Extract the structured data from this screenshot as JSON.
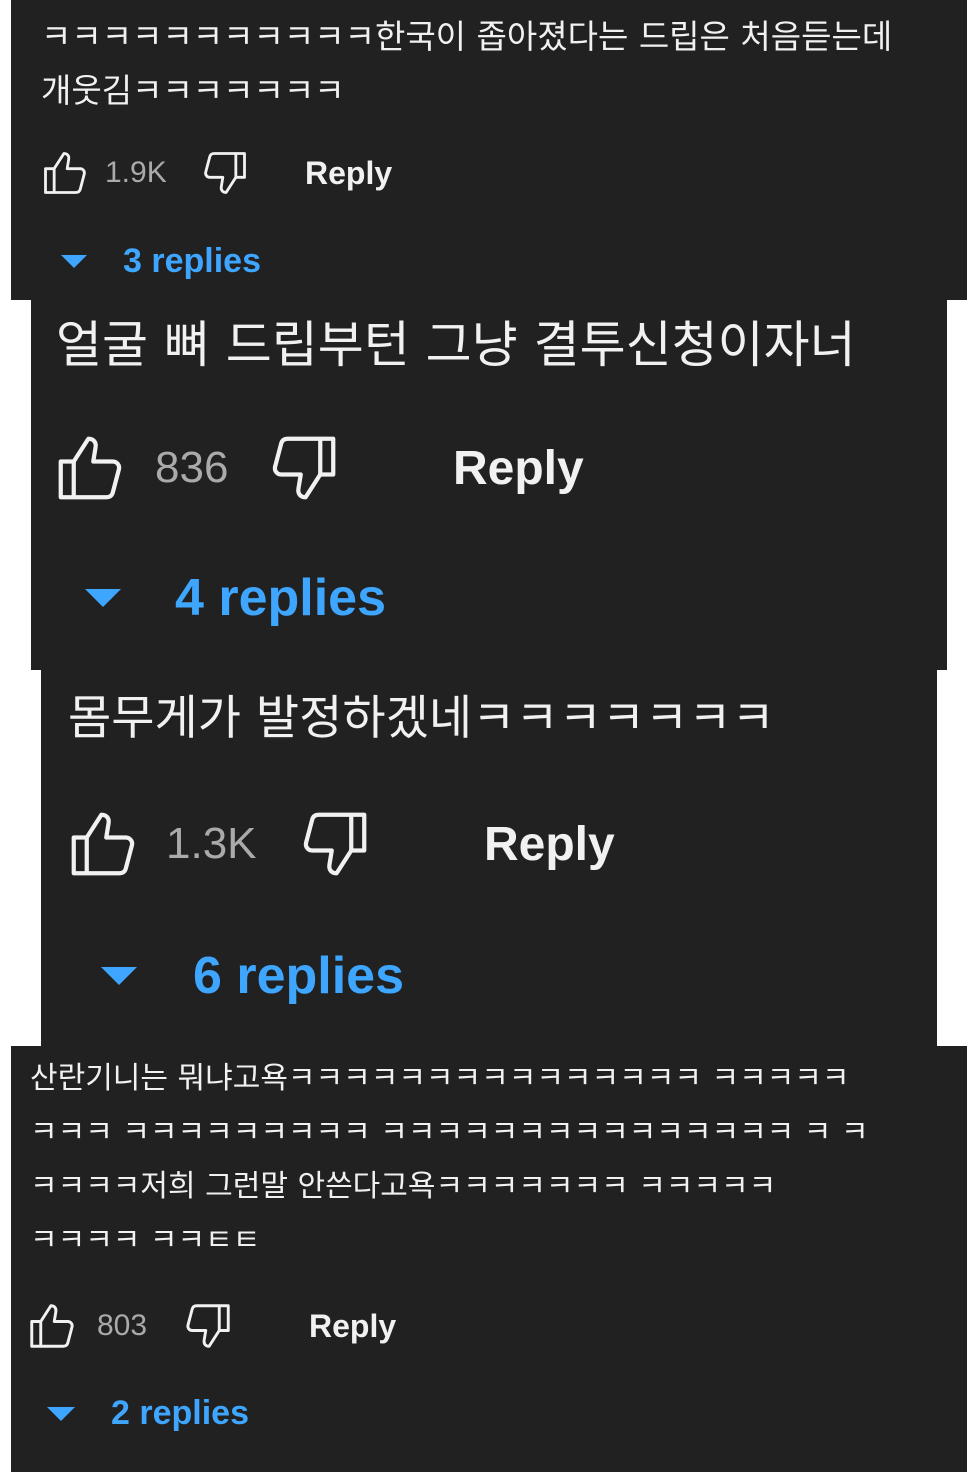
{
  "comments": [
    {
      "text": "ㅋㅋㅋㅋㅋㅋㅋㅋㅋㅋㅋ한국이 좁아졌다는 드립은 처음듣는데\n개웃김ㅋㅋㅋㅋㅋㅋㅋ",
      "likes": "1.9K",
      "reply_label": "Reply",
      "replies_label": "3 replies"
    },
    {
      "text": "얼굴 뼈 드립부턴 그냥 결투신청이자너",
      "likes": "836",
      "reply_label": "Reply",
      "replies_label": "4 replies"
    },
    {
      "text": "몸무게가 발정하겠네ㅋㅋㅋㅋㅋㅋㅋ",
      "likes": "1.3K",
      "reply_label": "Reply",
      "replies_label": "6 replies"
    },
    {
      "text": "산란기니는 뭐냐고욕ㅋㅋㅋㅋㅋㅋㅋㅋㅋㅋㅋㅋㅋㅋㅋ ㅋㅋㅋㅋㅋ\nㅋㅋㅋ ㅋㅋㅋㅋㅋㅋㅋㅋㅋ ㅋㅋㅋㅋㅋㅋㅋㅋㅋㅋㅋㅋㅋㅋㅋ ㅋ ㅋ\nㅋㅋㅋㅋ저희 그런말 안쓴다고욕ㅋㅋㅋㅋㅋㅋㅋ  ㅋㅋㅋㅋㅋ\nㅋㅋㅋㅋ ㅋㅋㅌㅌ",
      "likes": "803",
      "reply_label": "Reply",
      "replies_label": "2 replies"
    }
  ],
  "icons": {
    "like": "thumbs-up-outline-icon",
    "dislike": "thumbs-down-outline-icon",
    "expand": "caret-down-icon"
  },
  "colors": {
    "background": "#212121",
    "text": "#f1f1f1",
    "count": "#aaaaaa",
    "link": "#3ea6ff"
  }
}
